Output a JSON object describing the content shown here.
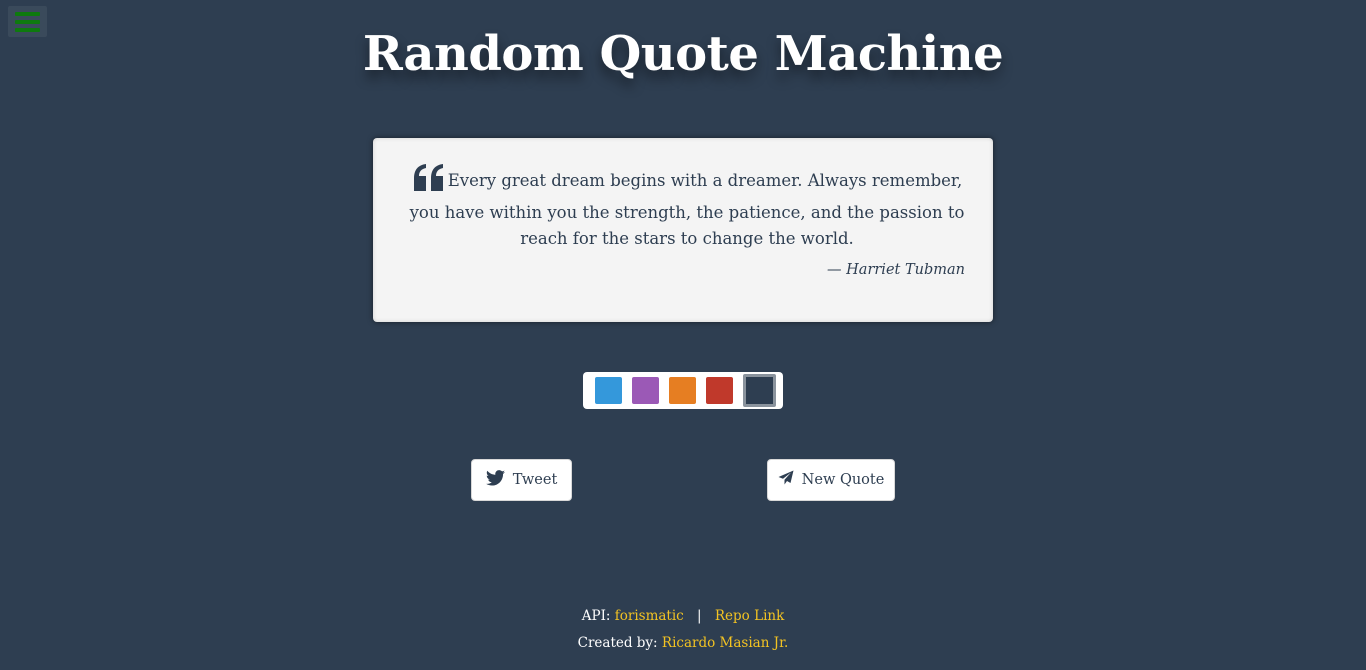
{
  "app": {
    "title": "Random Quote Machine"
  },
  "menu": {
    "icon": "hamburger-icon",
    "icon_color": "#0e7a0e"
  },
  "quote": {
    "text": "Every great dream begins with a dreamer. Always remember, you have within you the strength, the patience, and the passion to reach for the stars to change the world.",
    "author": "— Harriet Tubman",
    "icon": "quote-left-icon"
  },
  "theme": {
    "colors": [
      {
        "name": "blue",
        "hex": "#3498db"
      },
      {
        "name": "purple",
        "hex": "#9b59b6"
      },
      {
        "name": "orange",
        "hex": "#e67e22"
      },
      {
        "name": "red",
        "hex": "#c0392b"
      },
      {
        "name": "dark",
        "hex": "#2e3e51",
        "active": true
      }
    ],
    "background": "#2e3e51"
  },
  "actions": {
    "tweet_label": "Tweet",
    "tweet_icon": "twitter-icon",
    "new_quote_label": "New Quote",
    "new_quote_icon": "paper-plane-icon"
  },
  "footer": {
    "api_label": "API:",
    "api_link": "forismatic",
    "separator": "|",
    "repo_link": "Repo Link",
    "created_label": "Created by:",
    "author_link": "Ricardo Masian Jr.",
    "link_color": "#f3c322"
  }
}
